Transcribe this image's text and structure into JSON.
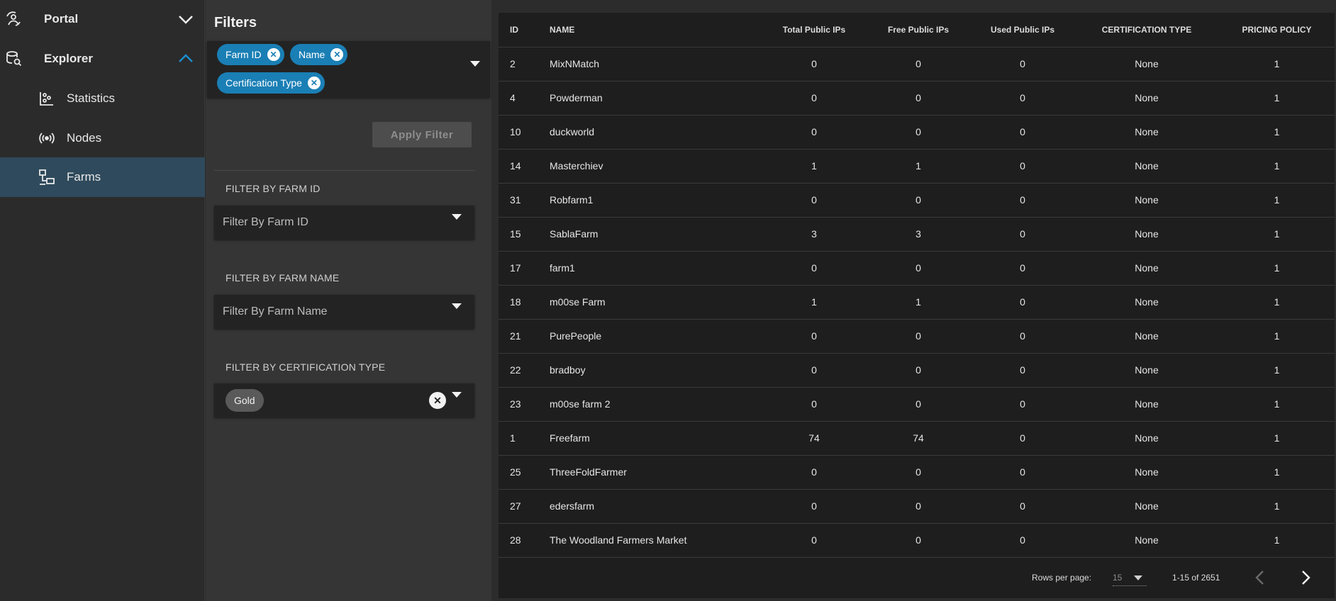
{
  "sidebar": {
    "portal": {
      "label": "Portal"
    },
    "explorer": {
      "label": "Explorer"
    },
    "items": [
      {
        "label": "Statistics"
      },
      {
        "label": "Nodes"
      },
      {
        "label": "Farms"
      }
    ],
    "active_item": "Farms",
    "accent_color": "#1a7fb5"
  },
  "filters": {
    "title": "Filters",
    "active_chips": [
      {
        "label": "Farm ID"
      },
      {
        "label": "Name"
      },
      {
        "label": "Certification Type"
      }
    ],
    "apply_button": "Apply Filter",
    "farm_id": {
      "section_label": "FILTER BY FARM ID",
      "placeholder": "Filter By Farm ID"
    },
    "farm_name": {
      "section_label": "FILTER BY FARM NAME",
      "placeholder": "Filter By Farm Name"
    },
    "cert_type": {
      "section_label": "FILTER BY CERTIFICATION TYPE",
      "selected": "Gold"
    }
  },
  "table": {
    "columns": [
      "ID",
      "NAME",
      "Total Public IPs",
      "Free Public IPs",
      "Used Public IPs",
      "CERTIFICATION TYPE",
      "PRICING POLICY"
    ],
    "rows": [
      [
        "2",
        "MixNMatch",
        "0",
        "0",
        "0",
        "None",
        "1"
      ],
      [
        "4",
        "Powderman",
        "0",
        "0",
        "0",
        "None",
        "1"
      ],
      [
        "10",
        "duckworld",
        "0",
        "0",
        "0",
        "None",
        "1"
      ],
      [
        "14",
        "Masterchiev",
        "1",
        "1",
        "0",
        "None",
        "1"
      ],
      [
        "31",
        "Robfarm1",
        "0",
        "0",
        "0",
        "None",
        "1"
      ],
      [
        "15",
        "SablaFarm",
        "3",
        "3",
        "0",
        "None",
        "1"
      ],
      [
        "17",
        "farm1",
        "0",
        "0",
        "0",
        "None",
        "1"
      ],
      [
        "18",
        "m00se Farm",
        "1",
        "1",
        "0",
        "None",
        "1"
      ],
      [
        "21",
        "PurePeople",
        "0",
        "0",
        "0",
        "None",
        "1"
      ],
      [
        "22",
        "bradboy",
        "0",
        "0",
        "0",
        "None",
        "1"
      ],
      [
        "23",
        "m00se farm 2",
        "0",
        "0",
        "0",
        "None",
        "1"
      ],
      [
        "1",
        "Freefarm",
        "74",
        "74",
        "0",
        "None",
        "1"
      ],
      [
        "25",
        "ThreeFoldFarmer",
        "0",
        "0",
        "0",
        "None",
        "1"
      ],
      [
        "27",
        "edersfarm",
        "0",
        "0",
        "0",
        "None",
        "1"
      ],
      [
        "28",
        "The Woodland Farmers Market",
        "0",
        "0",
        "0",
        "None",
        "1"
      ]
    ]
  },
  "pagination": {
    "rows_per_page_label": "Rows per page:",
    "rows_per_page": "15",
    "range": "1-15 of 2651"
  }
}
